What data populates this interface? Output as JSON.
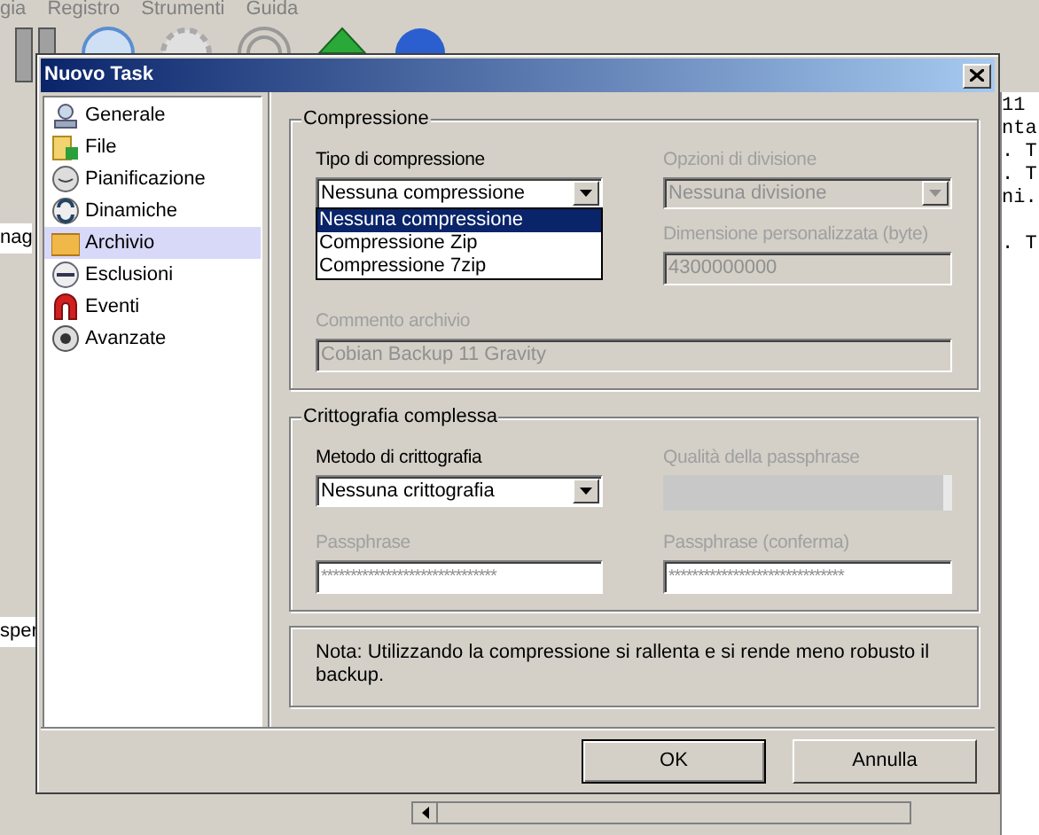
{
  "background_app": {
    "menu": [
      "gia",
      "Registro",
      "Strumenti",
      "Guida"
    ],
    "left_fragments": [
      "nag",
      "sper"
    ],
    "right_fragments": [
      "11",
      "nta",
      ". T",
      ". T",
      "ni.",
      ". T"
    ]
  },
  "dialog": {
    "title": "Nuovo Task",
    "sidebar": [
      {
        "label": "Generale",
        "selected": false
      },
      {
        "label": "File",
        "selected": false
      },
      {
        "label": "Pianificazione",
        "selected": false
      },
      {
        "label": "Dinamiche",
        "selected": false
      },
      {
        "label": "Archivio",
        "selected": true
      },
      {
        "label": "Esclusioni",
        "selected": false
      },
      {
        "label": "Eventi",
        "selected": false
      },
      {
        "label": "Avanzate",
        "selected": false
      }
    ],
    "compression": {
      "title": "Compressione",
      "type": {
        "label": "Tipo di compressione",
        "value": "Nessuna compressione",
        "disabled": false,
        "expanded": true,
        "options": [
          {
            "label": "Nessuna compressione",
            "selected": true
          },
          {
            "label": "Compressione Zip",
            "selected": false
          },
          {
            "label": "Compressione 7zip",
            "selected": false
          }
        ]
      },
      "split": {
        "label": "Opzioni di divisione",
        "value": "Nessuna divisione",
        "disabled": true
      },
      "custom_size": {
        "label": "Dimensione personalizzata (byte)",
        "value": "4300000000",
        "disabled": true
      },
      "comment": {
        "label": "Commento archivio",
        "value": "Cobian Backup 11 Gravity",
        "disabled": true
      }
    },
    "encryption": {
      "title": "Crittografia complessa",
      "method": {
        "label": "Metodo di crittografia",
        "value": "Nessuna crittografia",
        "disabled": false
      },
      "quality": {
        "label": "Qualità della passphrase",
        "level": 0,
        "disabled": true
      },
      "passphrase": {
        "label": "Passphrase",
        "value": "******************************",
        "disabled": true
      },
      "confirm": {
        "label": "Passphrase (conferma)",
        "value": "******************************",
        "disabled": true
      }
    },
    "note": "Nota: Utilizzando la compressione si rallenta e si rende meno robusto il backup.",
    "buttons": [
      "OK",
      "Annulla"
    ]
  }
}
